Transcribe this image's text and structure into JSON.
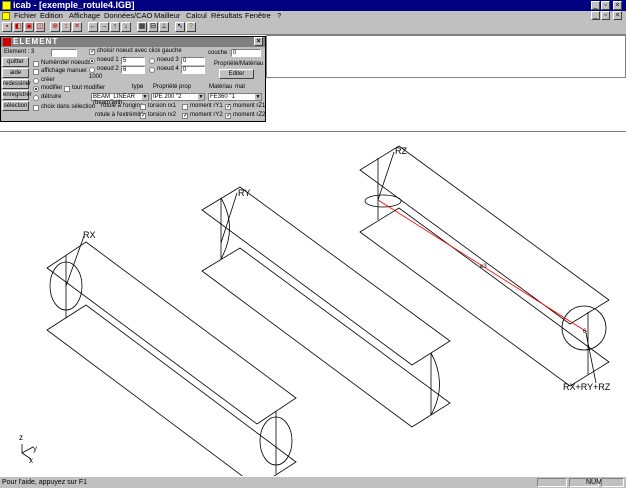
{
  "window": {
    "title": "icab - [exemple_rotule4.IGB]"
  },
  "menu": [
    "Fichier",
    "Edition",
    "Affichage",
    "Données/CAO",
    "Mailleur",
    "Calcul",
    "Résultats",
    "Fenêtre",
    "?"
  ],
  "panel": {
    "title": "ELEMENT",
    "element_label": "Element :",
    "element_number": "3",
    "buttons": {
      "quitter": "quitter",
      "aide": "aide",
      "redessiner": "redessiner",
      "enregistrer": "enregistrer",
      "selection": "sélection",
      "editer": "Editer"
    },
    "choisir_noeud": "choisir noeud avec click gauche",
    "couche_label": "couche :",
    "couche_value": "0",
    "propriete_materiau": "Propriété/Matériau",
    "numeroter_noeuds": "Numéroter noeuds",
    "affichage_manuel": "affichage manuel",
    "count_value": "1000",
    "noeud1_label": "noeud 1",
    "noeud1_value": "5",
    "noeud2_label": "noeud 2",
    "noeud2_value": "6",
    "noeud3_label": "noeud 3",
    "noeud3_value": "0",
    "noeud4_label": "noeud 4",
    "noeud4_value": "0",
    "creer": "créer",
    "modifier": "modifier",
    "tout_modifier": "tout modifier",
    "detruire": "détruire",
    "choix_selection": "choix dans sélection",
    "col_type": "type",
    "col_propriete": "Propriété",
    "col_prop": "prop",
    "col_materiau": "Matériau",
    "col_mat": "mat",
    "type_value": "BEAM_LINEAR (beam with",
    "prop_value": "IPE 200 \"2",
    "mat_value": "FE360 \"1",
    "rotule_origine": "rotule à l'origine",
    "rotule_extremite": "rotule à l'extrémité",
    "torsion_rx1": "torsion rx1",
    "moment_ry1": "moment rY1",
    "moment_rz1": "moment rZ1",
    "torsion_rx2": "torsion rx2",
    "moment_ry2": "moment rY2",
    "moment_rz2": "moment rZ2"
  },
  "drawing": {
    "labels": {
      "rx": "RX",
      "ry": "RY",
      "rz": "RZ",
      "rxryrz": "RX+RY+RZ",
      "elem": "e3",
      "node": "6"
    },
    "axes": {
      "z": "z",
      "y": "y",
      "x": "x"
    },
    "line_color": "#000000",
    "highlight_color": "#ff0000"
  },
  "status": {
    "text": "Pour l'aide, appuyez sur F1",
    "num": "NUM"
  }
}
